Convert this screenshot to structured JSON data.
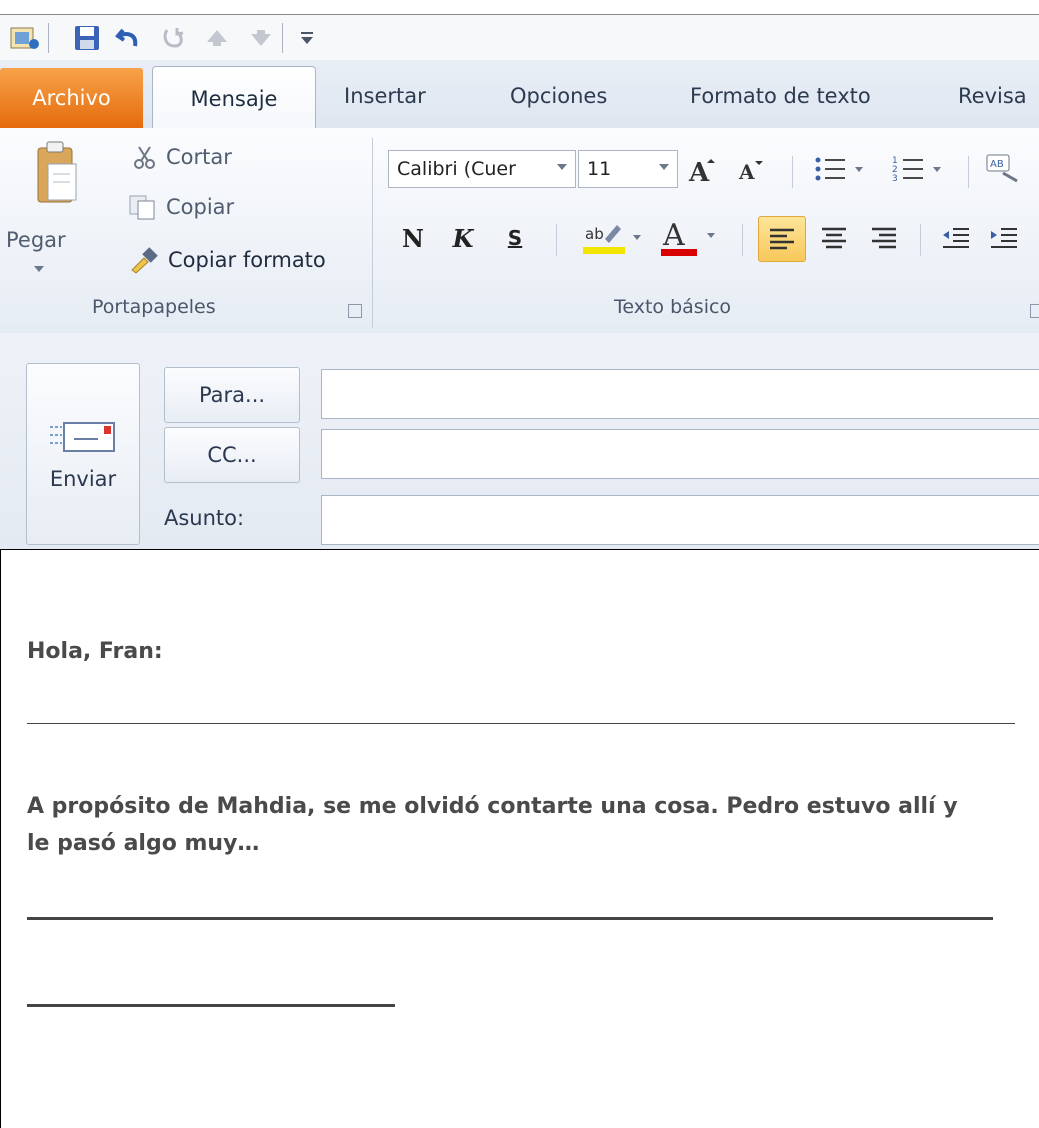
{
  "quick_access": {
    "icons": [
      "outlook-icon",
      "save-icon",
      "undo-icon",
      "redo-icon",
      "up-arrow-icon",
      "down-arrow-icon",
      "customize-icon"
    ]
  },
  "tabs": {
    "file": "Archivo",
    "message": "Mensaje",
    "insert": "Insertar",
    "options": "Opciones",
    "format_text": "Formato de texto",
    "review": "Revisa"
  },
  "ribbon": {
    "clipboard": {
      "paste": "Pegar",
      "cut": "Cortar",
      "copy": "Copiar",
      "format_painter": "Copiar formato",
      "group_label": "Portapapeles"
    },
    "basic_text": {
      "font_name": "Calibri (Cuer",
      "font_size": "11",
      "bold": "N",
      "italic": "K",
      "underline": "S",
      "highlight_label": "ab",
      "font_color_label": "A",
      "group_label": "Texto básico"
    }
  },
  "header": {
    "send": "Enviar",
    "to": "Para...",
    "cc": "CC...",
    "subject": "Asunto:",
    "to_value": "",
    "cc_value": "",
    "subject_value": ""
  },
  "body": {
    "greeting": "Hola, Fran:",
    "paragraph_line1": "A propósito de Mahdia, se me olvidó contarte una cosa. Pedro estuvo allí y",
    "paragraph_line2": "le pasó algo muy…"
  },
  "colors": {
    "file_tab": "#e56b0c",
    "highlight": "#f2e600",
    "font_color": "#d90000",
    "selected_align": "#f8c85a"
  }
}
